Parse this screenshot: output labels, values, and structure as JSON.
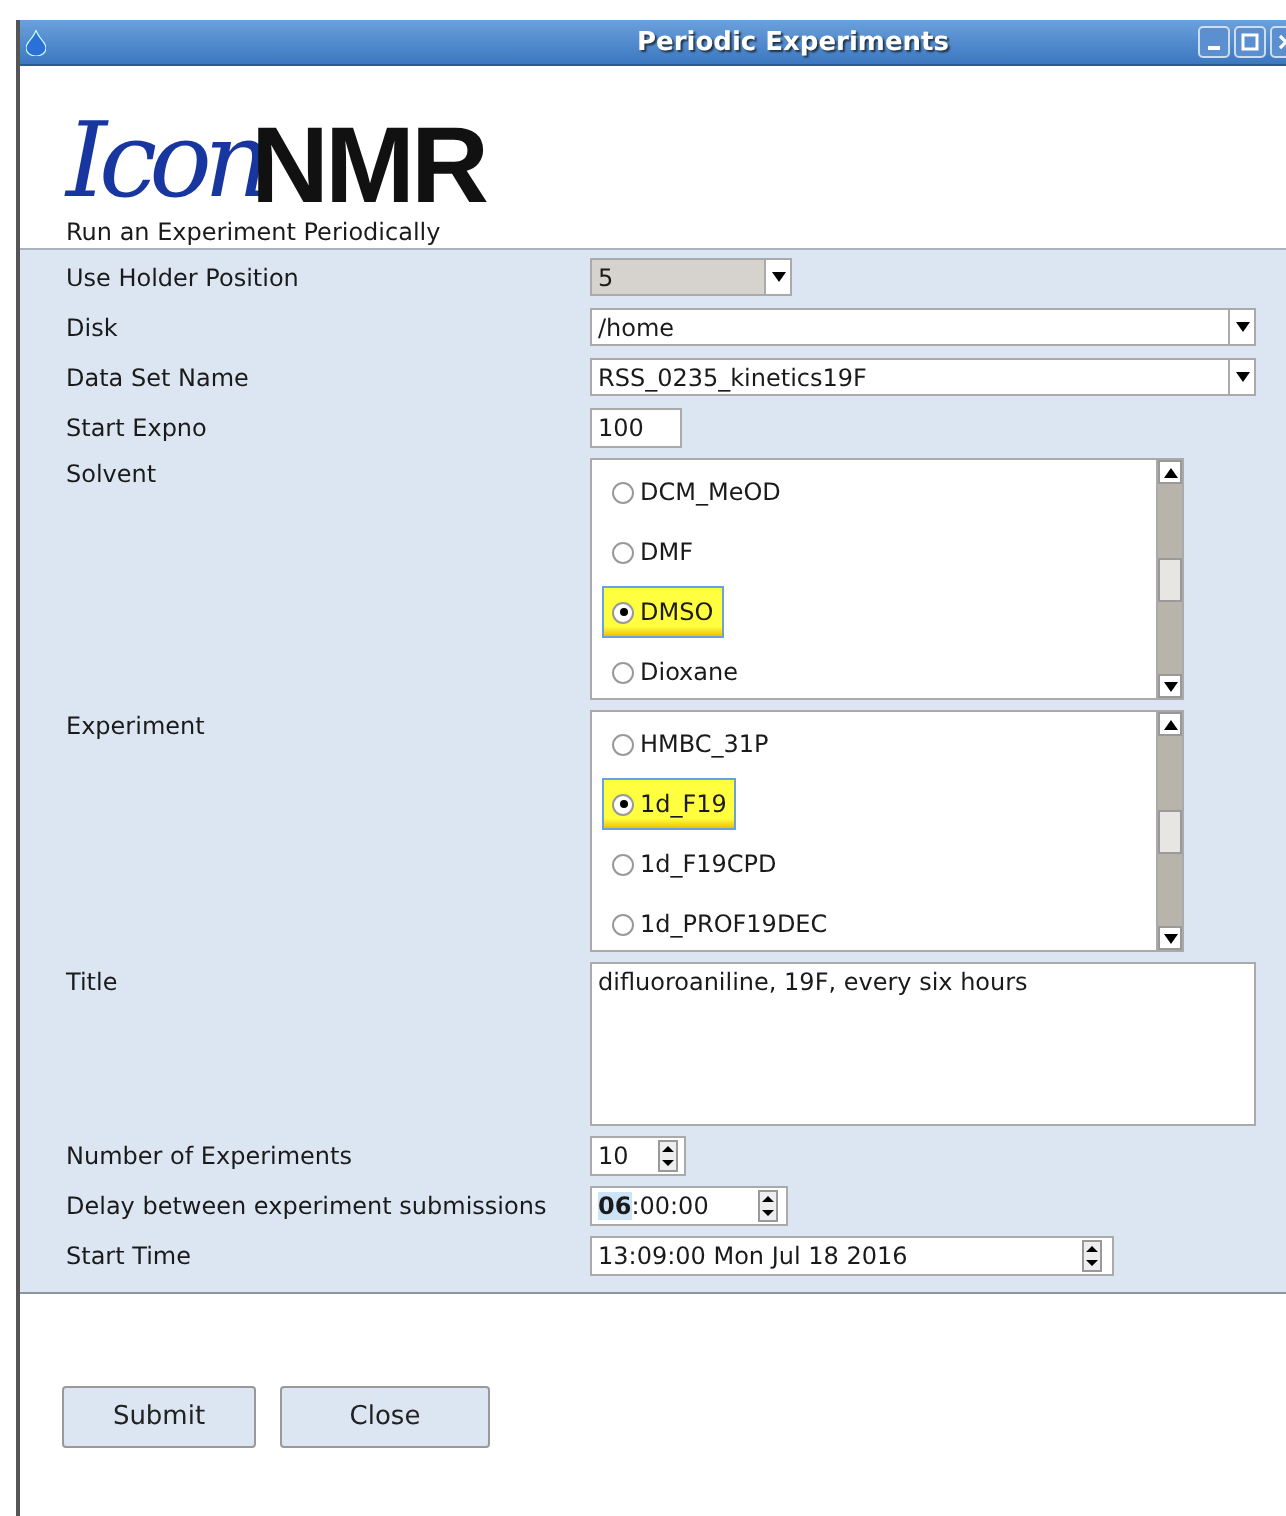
{
  "window": {
    "title": "Periodic Experiments"
  },
  "logo": {
    "script_part": "Icon",
    "bold_part": "NMR"
  },
  "subtitle": "Run an Experiment Periodically",
  "form": [
    {
      "kind": "combo",
      "label": "Use Holder Position",
      "value": "5",
      "editable": false
    },
    {
      "kind": "combo",
      "label": "Disk",
      "value": "/home",
      "editable": true
    },
    {
      "kind": "combo",
      "label": "Data Set Name",
      "value": "RSS_0235_kinetics19F",
      "editable": true
    },
    {
      "kind": "text",
      "label": "Start Expno",
      "value": "100"
    },
    {
      "kind": "radio-list",
      "label": "Solvent",
      "options": [
        {
          "label": "DCM_MeOD",
          "selected": false
        },
        {
          "label": "DMF",
          "selected": false
        },
        {
          "label": "DMSO",
          "selected": true
        },
        {
          "label": "Dioxane",
          "selected": false
        }
      ]
    },
    {
      "kind": "radio-list",
      "label": "Experiment",
      "options": [
        {
          "label": "HMBC_31P",
          "selected": false
        },
        {
          "label": "1d_F19",
          "selected": true
        },
        {
          "label": "1d_F19CPD",
          "selected": false
        },
        {
          "label": "1d_PROF19DEC",
          "selected": false
        }
      ]
    },
    {
      "kind": "textarea",
      "label": "Title",
      "value": "difluoroaniline, 19F, every six hours"
    },
    {
      "kind": "spin",
      "label": "Number of Experiments",
      "value": "10"
    },
    {
      "kind": "time",
      "label": "Delay between experiment submissions",
      "highlight": "06",
      "rest": ":00:00"
    },
    {
      "kind": "datetime",
      "label": "Start Time",
      "value": "13:09:00 Mon Jul 18 2016"
    }
  ],
  "buttons": [
    "Submit",
    "Close"
  ]
}
